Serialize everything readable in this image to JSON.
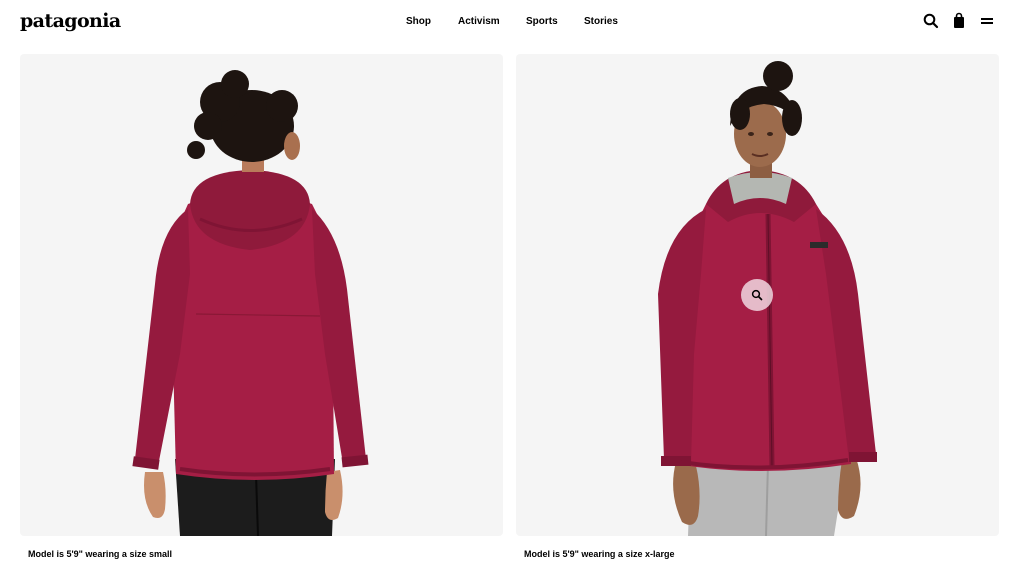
{
  "header": {
    "logo": "patagonia",
    "nav": [
      "Shop",
      "Activism",
      "Sports",
      "Stories"
    ],
    "icons": [
      "search-icon",
      "shopping-bag-icon",
      "menu-icon"
    ]
  },
  "gallery": {
    "images": [
      {
        "caption": "Model is 5'9\" wearing a size small",
        "view": "back"
      },
      {
        "caption": "Model is 5'9\" wearing a size x-large",
        "view": "front"
      }
    ],
    "zoom_icon": "magnifier-icon"
  },
  "colors": {
    "jacket": "#a51e45",
    "jacket_shadow": "#7f1434",
    "panel_bg": "#f5f5f5",
    "zoom_bg": "#f0d7e1"
  }
}
